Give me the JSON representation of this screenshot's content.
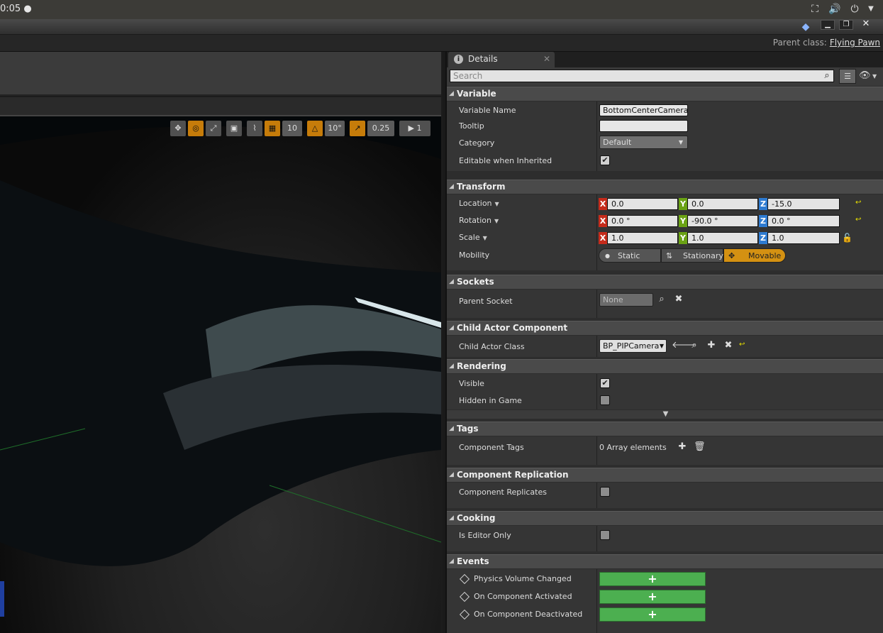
{
  "os_bar": {
    "clock": "0:05 ●"
  },
  "window": {
    "parent_class_label": "Parent class:",
    "parent_class_value": "Flying Pawn"
  },
  "viewport_toolbar": {
    "grid_snap": "10",
    "rotation_snap": "10°",
    "scale_snap": "0.25",
    "camera_speed": "1"
  },
  "details": {
    "tab_label": "Details",
    "search_placeholder": "Search",
    "sections": {
      "variable": "Variable",
      "transform": "Transform",
      "sockets": "Sockets",
      "child_actor": "Child Actor Component",
      "rendering": "Rendering",
      "tags": "Tags",
      "replication": "Component Replication",
      "cooking": "Cooking",
      "events": "Events"
    },
    "variable": {
      "name_label": "Variable Name",
      "name_value": "BottomCenterCamera",
      "tooltip_label": "Tooltip",
      "tooltip_value": "",
      "category_label": "Category",
      "category_value": "Default",
      "editable_label": "Editable when Inherited",
      "editable_checked": true
    },
    "transform": {
      "location_label": "Location",
      "location": {
        "x": "0.0",
        "y": "0.0",
        "z": "-15.0"
      },
      "rotation_label": "Rotation",
      "rotation": {
        "x": "0.0 °",
        "y": "-90.0 °",
        "z": "0.0 °"
      },
      "scale_label": "Scale",
      "scale": {
        "x": "1.0",
        "y": "1.0",
        "z": "1.0"
      },
      "mobility_label": "Mobility",
      "mobility_static": "Static",
      "mobility_stationary": "Stationary",
      "mobility_movable": "Movable",
      "axis_x": "X",
      "axis_y": "Y",
      "axis_z": "Z"
    },
    "sockets": {
      "parent_socket_label": "Parent Socket",
      "parent_socket_value": "None"
    },
    "child_actor": {
      "class_label": "Child Actor Class",
      "class_value": "BP_PIPCamera"
    },
    "rendering": {
      "visible_label": "Visible",
      "visible_checked": true,
      "hidden_label": "Hidden in Game",
      "hidden_checked": false
    },
    "tags": {
      "component_tags_label": "Component Tags",
      "array_text": "0 Array elements"
    },
    "replication": {
      "replicates_label": "Component Replicates"
    },
    "cooking": {
      "editor_only_label": "Is Editor Only"
    },
    "events": {
      "items": [
        "Physics Volume Changed",
        "On Component Activated",
        "On Component Deactivated"
      ],
      "add_glyph": "+"
    }
  }
}
